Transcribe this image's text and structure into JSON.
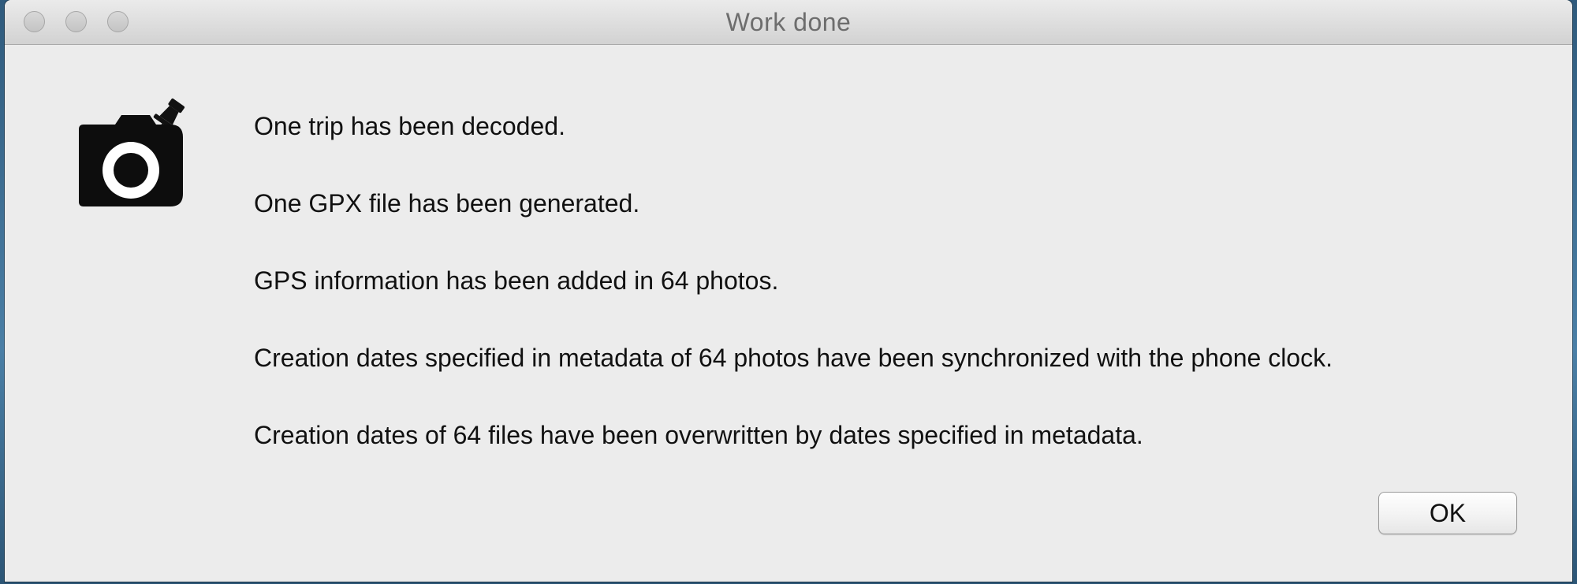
{
  "window": {
    "title": "Work done"
  },
  "dialog": {
    "icon": "camera-with-pushpin-icon",
    "messages": [
      "One trip has been decoded.",
      "One GPX file has been generated.",
      "GPS information has been added in 64 photos.",
      "Creation dates specified in metadata of 64 photos have been synchronized with the phone clock.",
      "Creation dates of 64 files have been overwritten by dates specified in metadata."
    ],
    "ok_label": "OK"
  },
  "colors": {
    "window_background": "#ececec",
    "title_text": "#6d6d6d",
    "body_text": "#111111",
    "desktop": "#3b6a8f"
  }
}
